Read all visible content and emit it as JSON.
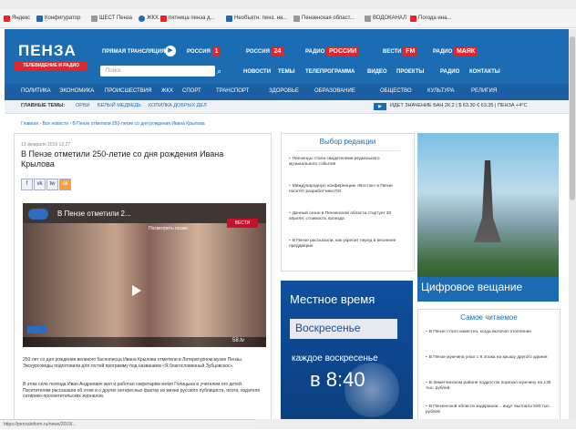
{
  "bookmarks": [
    {
      "label": "Яндекс",
      "color": "#e3262d"
    },
    {
      "label": "Конфигуратор",
      "color": "#1b6cb3"
    },
    {
      "label": "ШЕСТ Пенза",
      "color": "#999999"
    },
    {
      "label": "ЖКХ",
      "color": "#1b6cb3"
    },
    {
      "label": "пятница пенза д...",
      "color": "#e3262d"
    },
    {
      "label": "Необъятн. пенз. на...",
      "color": "#1b6cb3"
    },
    {
      "label": "Пензенская област...",
      "color": "#999999"
    },
    {
      "label": "ВОДОКАНАЛ",
      "color": "#999999"
    },
    {
      "label": "Погода ина...",
      "color": "#e3262d"
    }
  ],
  "header": {
    "logo": "ПЕНЗА",
    "logo_sub": "ТЕЛЕВИДЕНИЕ И РАДИО",
    "live": "ПРЯМАЯ ТРАНСЛЯЦИЯ",
    "russia1": "РОССИЯ",
    "russia1_num": "1",
    "russia24": "РОССИЯ",
    "russia24_num": "24",
    "radio_russia": "РАДИО",
    "radio_russia_badge": "РОССИИ",
    "vesti": "ВЕСТИ",
    "vesti_badge": "FM",
    "radio_mayak": "РАДИО",
    "radio_mayak_badge": "МАЯК",
    "search_placeholder": "Поиск",
    "links": [
      "НОВОСТИ",
      "ТЕМЫ",
      "ТЕЛЕПРОГРАММА",
      "ВИДЕО",
      "ПРОЕКТЫ",
      "РАДИО",
      "КОНТАКТЫ"
    ]
  },
  "nav": [
    "ПОЛИТИКА",
    "ЭКОНОМИКА",
    "ПРОИСШЕСТВИЯ",
    "ЖКХ",
    "СПОРТ",
    "ТРАНСПОРТ",
    "ЗДОРОВЬЕ",
    "ОБРАЗОВАНИЕ",
    "ОБЩЕСТВО",
    "КУЛЬТУРА",
    "РЕЛИГИЯ"
  ],
  "subnav": {
    "main_topics": "ГЛАВНЫЕ ТЕМЫ:",
    "topics": [
      "ОРВИ",
      "БЕЛЫЙ МЕДВЕДЬ",
      "КОПИЛКА ДОБРЫХ ДЕЛ"
    ],
    "ticker": "ИДЕТ ЗНАЧЕНИЕ БАН 2К 2   |  $ 63.30  € 63.35   |  ПЕНЗА +4°С"
  },
  "breadcrumb": "Главная › Все новости › В Пензе отметили 250-летие со дня рождения Ивана Крылова",
  "article": {
    "date": "13 февраля 2019 12:27",
    "title": "В Пензе отметили 250-летие со дня рождения Ивана Крылова",
    "share": [
      "f",
      "vk",
      "tw",
      "ok"
    ],
    "video_title": "В Пензе отметили 2...",
    "video_overlay": "Посмотреть позже",
    "video_badge": "ВЕСТИ",
    "video_source": "58.tv",
    "paragraph1": "250 лет со дня рождения великого баснописца Ивана Крылова отметили в Литературном музее Пензы. Экскурсоводы подготовили для гостей программу под названием «Я благословенный Зубцовскос».",
    "paragraph2": "В этом селе полгода Иван Андреевич жил и работал секретарём князя Голицына и учителем его детей. Посетителям рассказали об этом и о других интересных фактах из жизни русского публициста, поэта, издателя сатирико-просветительских журналов."
  },
  "editor": {
    "title": "Выбор редакции",
    "items": [
      "Пензенцы стали свидетелями редкального музыкального события",
      "Международную конференцию «Восток» в Пензе посетят разработчики ПО",
      "Дачный сезон в Пензенской области стартует 20 апреля: стоимость проезда",
      "В Пензе рассказали, как укрепит перед в весеннее преддверие"
    ]
  },
  "promo_digital": "Цифровое вещание",
  "promo_time": {
    "line1": "Местное время",
    "line2": "Воскресенье",
    "line3": "каждое воскресенье",
    "time": "в 8:40"
  },
  "most_read": {
    "title": "Самое читаемое",
    "items": [
      "В Пензе стало известно, когда включат отопление",
      "В Пензе мужчина упал с 8 этажа на крышу другого здания",
      "В Земетчинском районе подросток порезал мужчину на 130 тыс. рублей",
      "В Пензенской области задержали... ищут выплаты 500 тыс. рублей"
    ]
  },
  "status_url": "https://penzainform.ru/news/2019/...",
  "colors": {
    "brand": "#1b6cb3",
    "accent": "#e3262d"
  }
}
